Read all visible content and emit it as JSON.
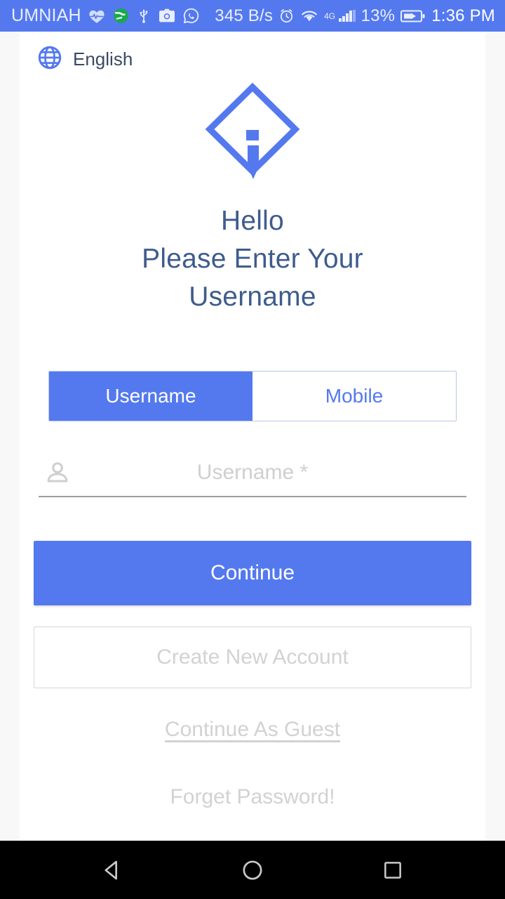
{
  "status_bar": {
    "carrier": "UMNIAH",
    "icons": [
      "heart-pulse-icon",
      "earth-globe-icon",
      "usb-icon",
      "camera-icon",
      "whatsapp-icon"
    ],
    "network_speed": "345 B/s",
    "alarm_icon": "alarm-clock-icon",
    "wifi_icon": "wifi-icon",
    "network_type": "4G",
    "signal_icon": "cellular-signal-icon",
    "battery_percent": "13%",
    "battery_icon": "battery-charging-icon",
    "clock": "1:36 PM",
    "background_color": "#5479ef",
    "text_color": "#e9eefd"
  },
  "language_selector": {
    "icon": "globe-icon",
    "label": "English"
  },
  "logo": {
    "name": "app-logo-diamond-i",
    "color": "#5479ef"
  },
  "heading": {
    "line1": "Hello",
    "line2": "Please Enter Your",
    "line3": "Username",
    "color": "#3e5c8d"
  },
  "tabs": [
    {
      "label": "Username",
      "active": true
    },
    {
      "label": "Mobile",
      "active": false
    }
  ],
  "username_field": {
    "icon": "person-icon",
    "placeholder": "Username *",
    "value": ""
  },
  "buttons": {
    "continue": "Continue",
    "create_account": "Create New Account"
  },
  "links": {
    "guest": "Continue As Guest",
    "forgot": "Forget Password!"
  },
  "nav_bar": {
    "back": "back-triangle-icon",
    "home": "home-circle-icon",
    "recents": "recents-square-icon"
  },
  "colors": {
    "accent": "#5479ef",
    "heading": "#3e5c8d",
    "muted": "#d2d2d2",
    "card": "#ffffff",
    "page": "#f8f8f9"
  }
}
